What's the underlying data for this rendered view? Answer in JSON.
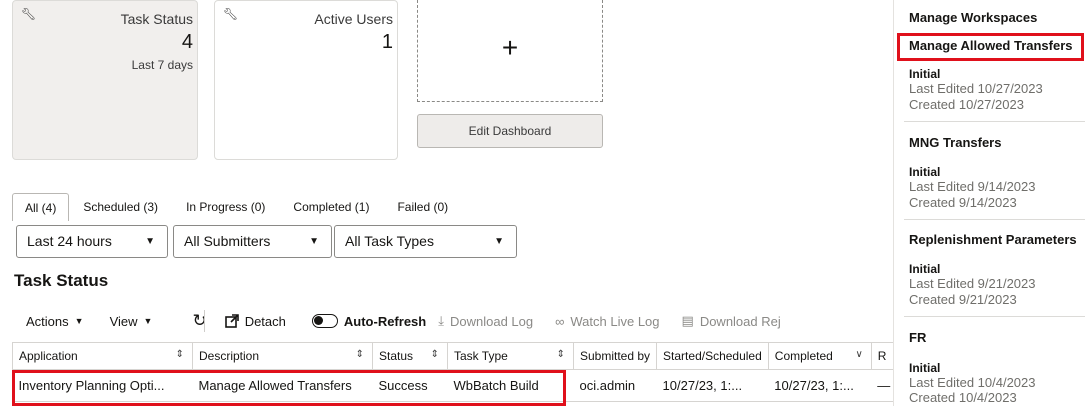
{
  "cards": {
    "task_status": {
      "title": "Task Status",
      "value": "4",
      "sub": "Last 7 days"
    },
    "active_users": {
      "title": "Active Users",
      "value": "1"
    }
  },
  "add_tile": {
    "plus": "+"
  },
  "edit_dashboard_label": "Edit Dashboard",
  "tabs": [
    {
      "label": "All (4)",
      "active": true
    },
    {
      "label": "Scheduled (3)"
    },
    {
      "label": "In Progress (0)"
    },
    {
      "label": "Completed (1)"
    },
    {
      "label": "Failed (0)"
    }
  ],
  "filters": {
    "time": "Last 24 hours",
    "submitters": "All Submitters",
    "task_types": "All Task Types"
  },
  "section_title": "Task Status",
  "toolbar": {
    "actions": "Actions",
    "view": "View",
    "detach": "Detach",
    "auto_refresh": "Auto-Refresh",
    "download_log": "Download Log",
    "watch_live_log": "Watch Live Log",
    "download_report": "Download Rej"
  },
  "table": {
    "columns": [
      "Application",
      "Description",
      "Status",
      "Task Type",
      "Submitted by",
      "Started/Scheduled",
      "Completed",
      "R"
    ],
    "rows": [
      [
        "Inventory Planning Opti...",
        "Manage Allowed Transfers",
        "Success",
        "WbBatch Build",
        "oci.admin",
        "10/27/23, 1:...",
        "10/27/23, 1:...",
        "—"
      ]
    ]
  },
  "right_panel": {
    "items": [
      {
        "title": "Manage Workspaces"
      },
      {
        "title": "Manage Allowed Transfers",
        "state": "Initial",
        "edited": "Last Edited 10/27/2023",
        "created": "Created 10/27/2023"
      },
      {
        "title": "MNG Transfers",
        "state": "Initial",
        "edited": "Last Edited 9/14/2023",
        "created": "Created 9/14/2023"
      },
      {
        "title": "Replenishment Parameters",
        "state": "Initial",
        "edited": "Last Edited 9/21/2023",
        "created": "Created 9/21/2023"
      },
      {
        "title": "FR",
        "state": "Initial",
        "edited": "Last Edited 10/4/2023",
        "created": "Created 10/4/2023"
      }
    ]
  },
  "colors": {
    "highlight": "#e0101b",
    "text": "#161513",
    "muted": "#6f6e6a"
  }
}
